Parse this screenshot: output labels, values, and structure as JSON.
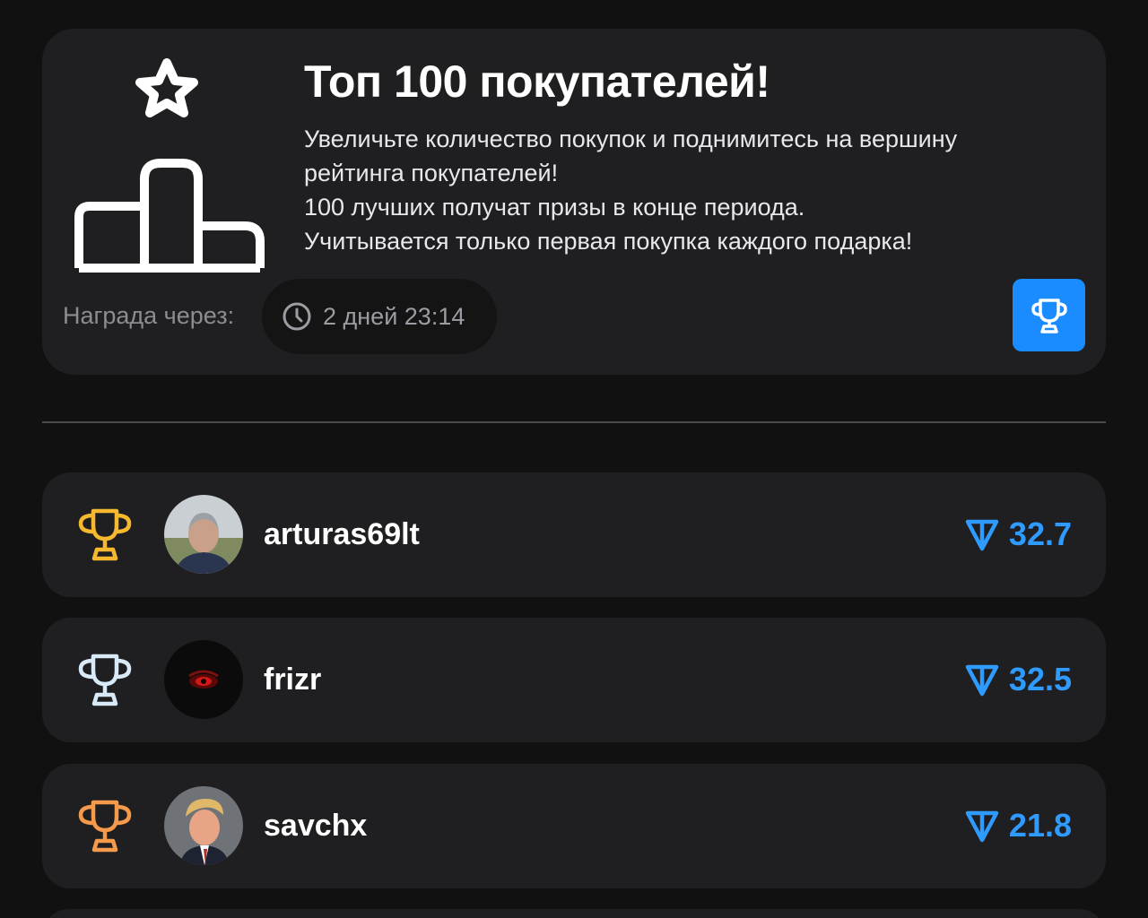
{
  "hero": {
    "title": "Топ 100 покупателей!",
    "description_lines": [
      "Увеличьте количество покупок и поднимитесь на вершину",
      "рейтинга покупателей!",
      "100 лучших получат призы в конце периода.",
      "Учитывается только первая покупка каждого подарка!"
    ],
    "reward_label": "Награда через:",
    "timer": "2 дней 23:14",
    "icons": {
      "podium": "podium-star-icon",
      "timer": "clock-icon",
      "button": "trophy-icon"
    },
    "accent_color": "#1a8cff"
  },
  "leaderboard": [
    {
      "rank": 1,
      "trophy_color": "#f5b82e",
      "username": "arturas69lt",
      "score": "32.7",
      "currency_icon": "ton-icon"
    },
    {
      "rank": 2,
      "trophy_color": "#d8eaf7",
      "username": "frizr",
      "score": "32.5",
      "currency_icon": "ton-icon"
    },
    {
      "rank": 3,
      "trophy_color": "#f59a4a",
      "username": "savchx",
      "score": "21.8",
      "currency_icon": "ton-icon"
    }
  ],
  "colors": {
    "background": "#111112",
    "card": "#1f1f21",
    "score": "#2f9bff"
  }
}
